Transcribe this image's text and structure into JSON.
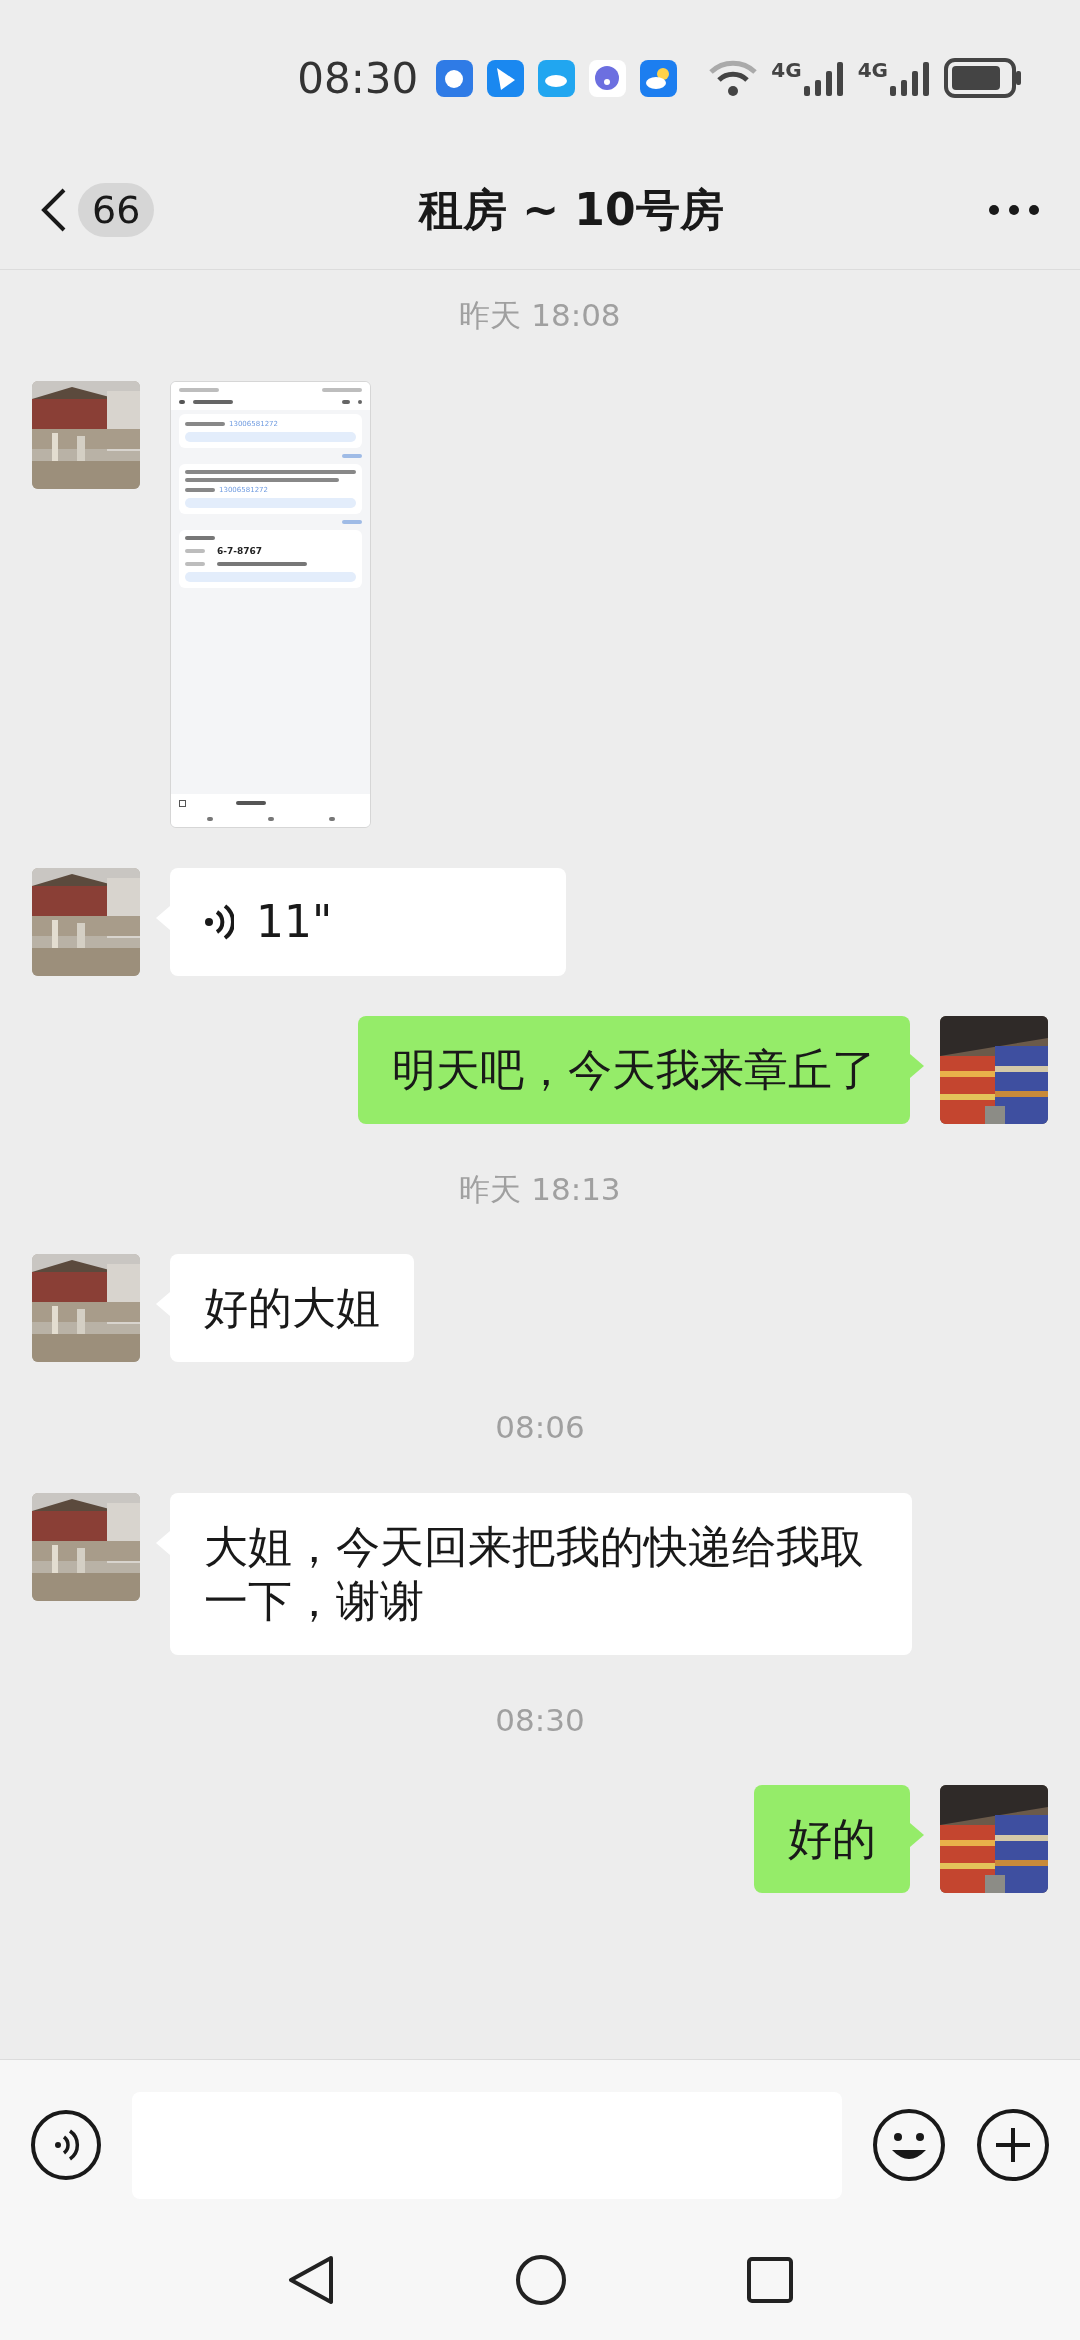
{
  "status_bar": {
    "time": "08:30",
    "network_labels": [
      "4G",
      "4G"
    ]
  },
  "header": {
    "back_count": "66",
    "title": "租房 ~ 10号房"
  },
  "messages": [
    {
      "kind": "time",
      "text": "昨天 18:08"
    },
    {
      "outgoing": false,
      "phone_numbers": [
        "13006581272",
        "13006581272"
      ],
      "code": "6-7-8767"
    },
    {
      "kind": "voice",
      "outgoing": false,
      "text": "11\""
    },
    {
      "kind": "text",
      "outgoing": true,
      "text": "明天吧，今天我来章丘了"
    },
    {
      "kind": "time",
      "text": "昨天 18:13"
    },
    {
      "kind": "text",
      "outgoing": false,
      "text": "好的大姐"
    },
    {
      "kind": "time",
      "text": "08:06"
    },
    {
      "kind": "text",
      "outgoing": false,
      "text": "大姐，今天回来把我的快递给我取一下，谢谢"
    },
    {
      "kind": "time",
      "text": "08:30"
    },
    {
      "kind": "text",
      "outgoing": true,
      "text": "好的"
    }
  ]
}
